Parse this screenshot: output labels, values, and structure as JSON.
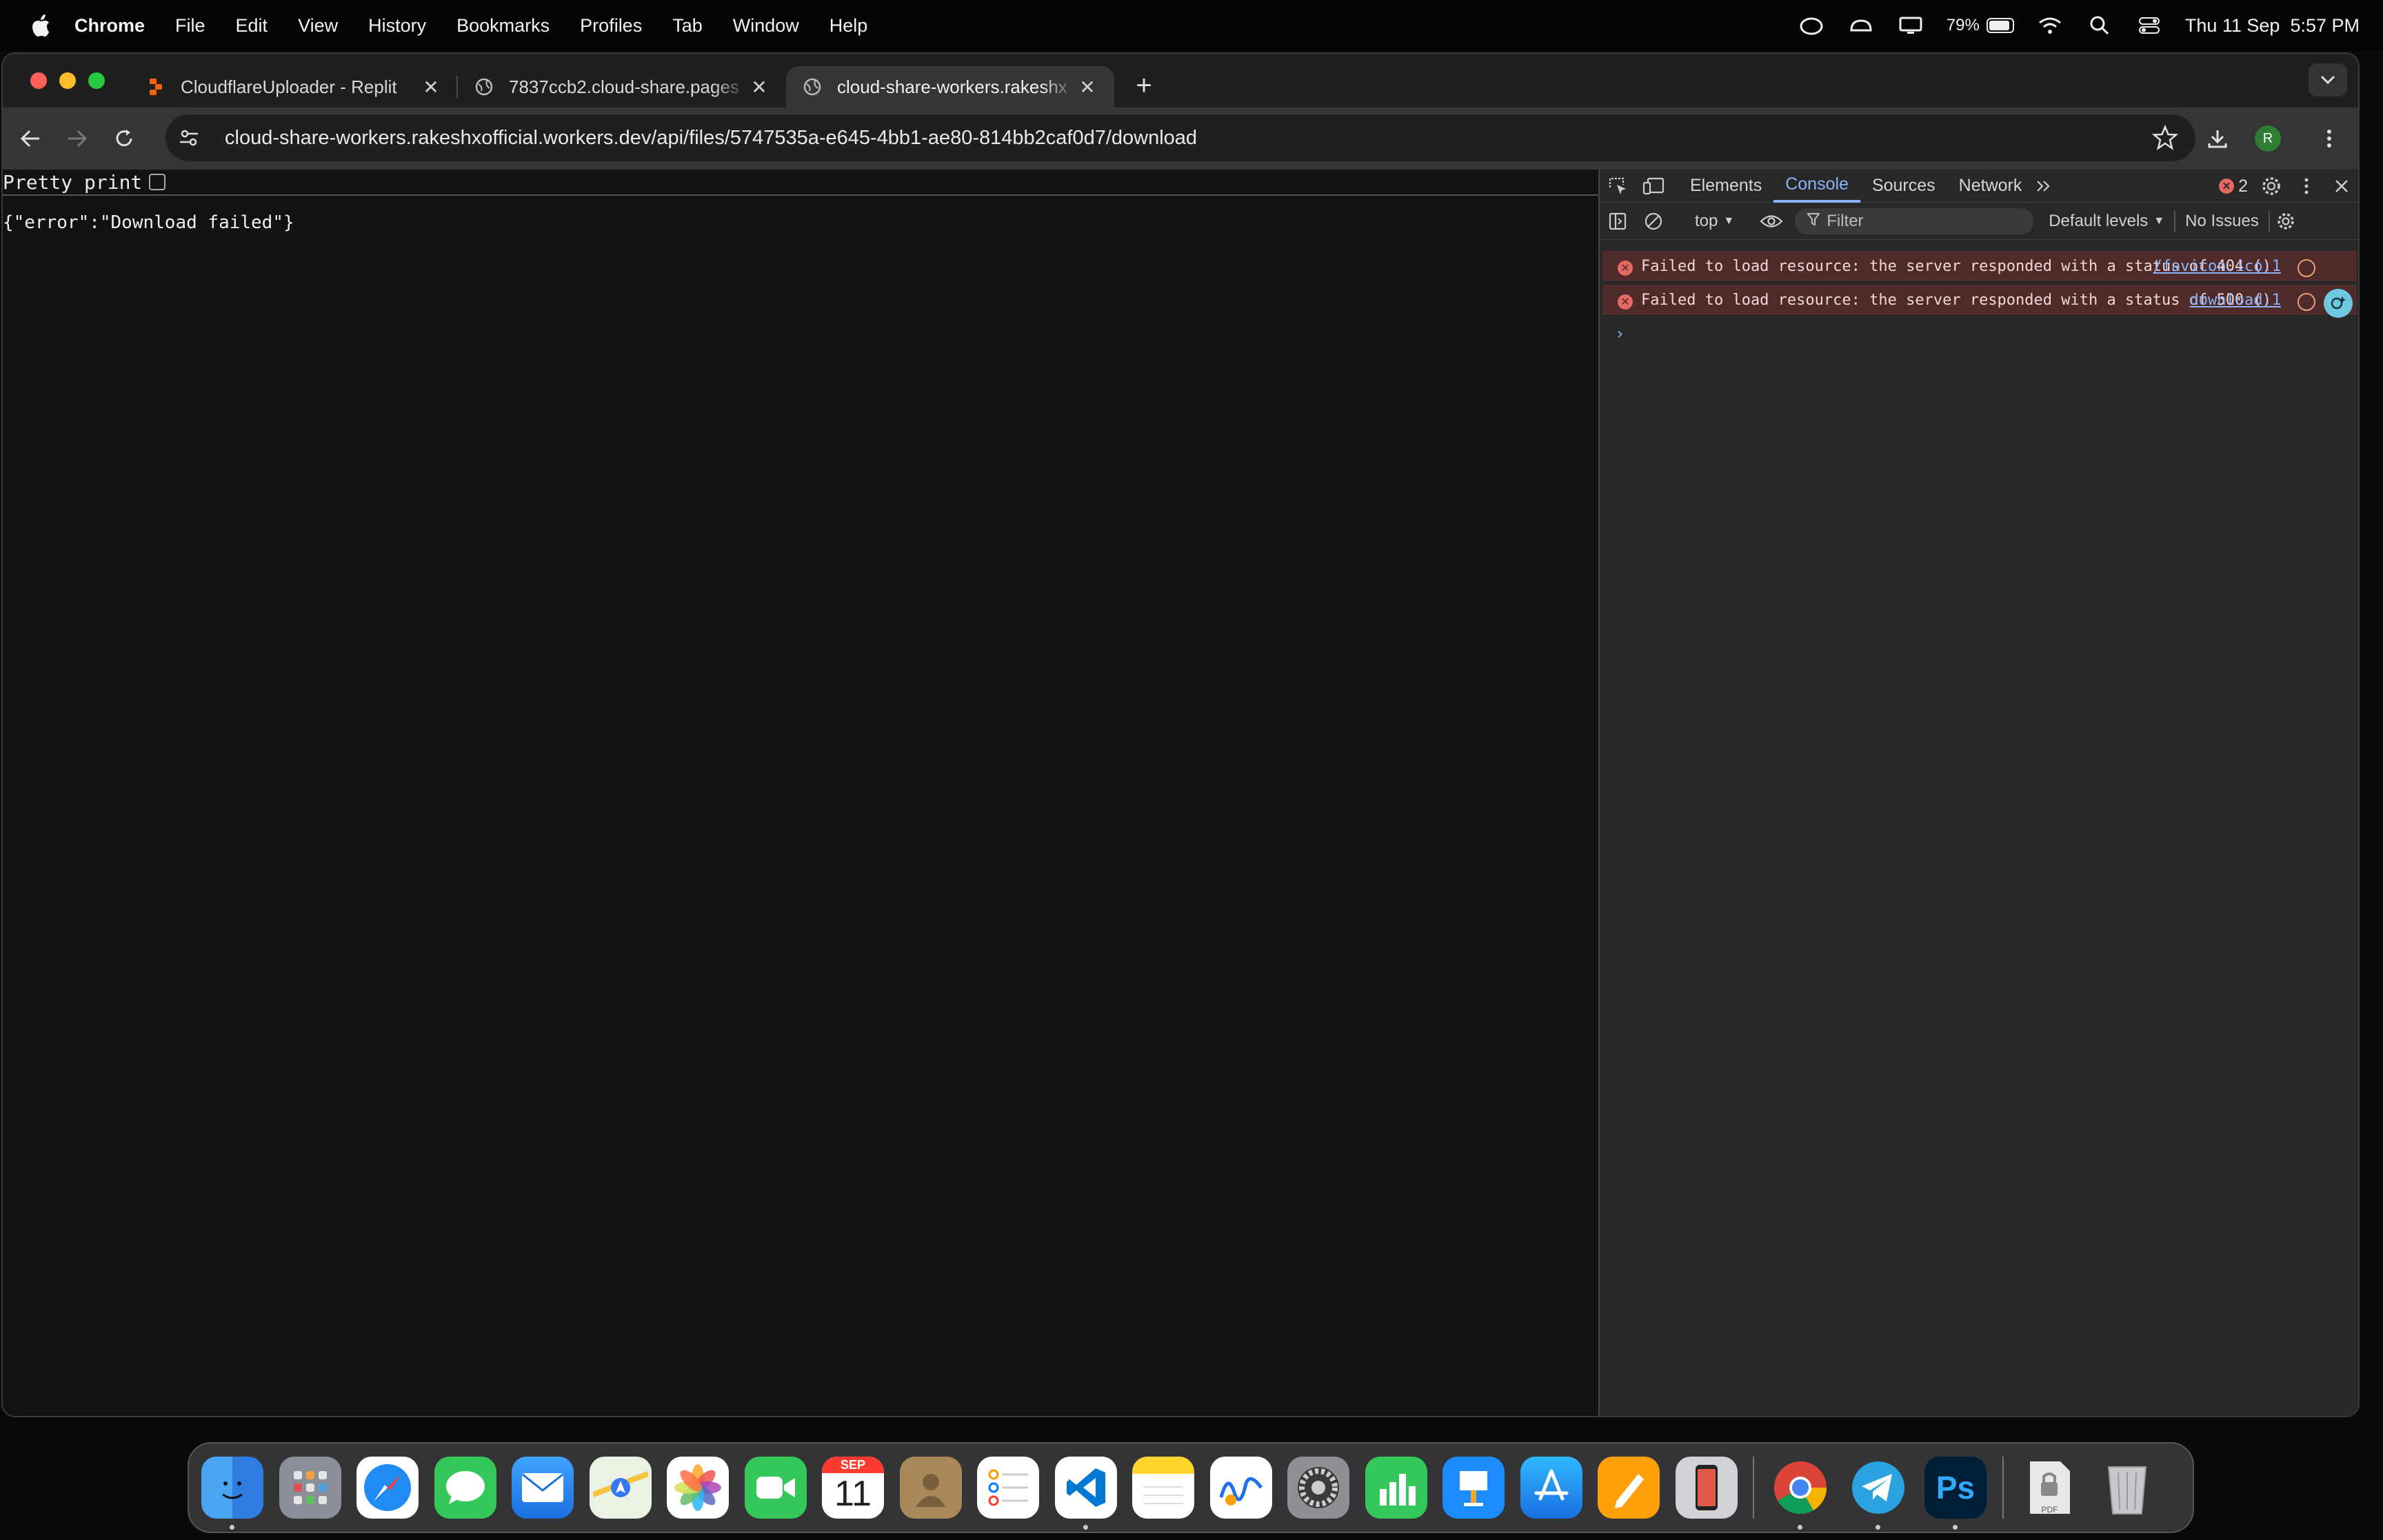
{
  "menubar": {
    "app": "Chrome",
    "items": [
      "File",
      "Edit",
      "View",
      "History",
      "Bookmarks",
      "Profiles",
      "Tab",
      "Window",
      "Help"
    ],
    "battery": "79%",
    "datetime": "Thu 11 Sep  5:57 PM"
  },
  "tabs": [
    {
      "title": "CloudflareUploader - Replit",
      "icon": "replit-icon"
    },
    {
      "title": "7837ccb2.cloud-share.pages",
      "icon": "globe-icon"
    },
    {
      "title": "cloud-share-workers.rakeshx",
      "icon": "globe-icon"
    }
  ],
  "toolbar": {
    "url": "cloud-share-workers.rakeshxofficial.workers.dev/api/files/5747535a-e645-4bb1-ae80-814bb2caf0d7/download",
    "avatar": "R"
  },
  "page": {
    "pretty_print": "Pretty print",
    "json": "{\"error\":\"Download failed\"}"
  },
  "devtools": {
    "tabs": [
      "Elements",
      "Console",
      "Sources",
      "Network"
    ],
    "error_count": "2",
    "context": "top",
    "filter_placeholder": "Filter",
    "levels": "Default levels",
    "issues": "No Issues",
    "messages": [
      {
        "text": "Failed to load resource: the server responded with a status of 404 ()",
        "source": "/favicon.ico:1"
      },
      {
        "text": "Failed to load resource: the server responded with a status of 500 ()",
        "source": "download:1"
      }
    ],
    "prompt": "›"
  },
  "dock": {
    "calendar_month": "SEP",
    "calendar_day": "11",
    "ps_label": "Ps",
    "pdf_label": "PDF"
  },
  "colors": {
    "accent": "#8ab4f8",
    "error_bg": "#4e2a2a",
    "close": "#ff5f57",
    "minimize": "#febc2e",
    "zoom": "#28c840"
  }
}
